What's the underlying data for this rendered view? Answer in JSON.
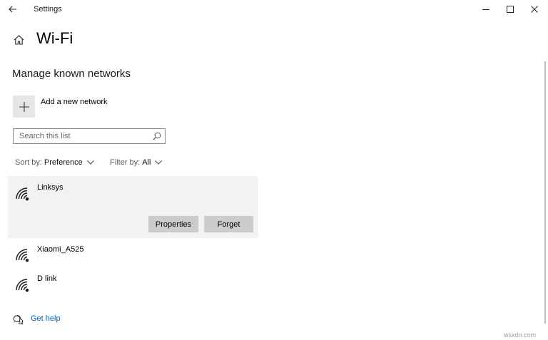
{
  "window": {
    "title": "Settings",
    "back_icon": "back-arrow-icon",
    "controls": [
      "minimize-icon",
      "maximize-icon",
      "close-icon"
    ]
  },
  "page": {
    "title": "Wi-Fi",
    "home_icon": "home-icon",
    "section_title": "Manage known networks"
  },
  "add_network": {
    "label": "Add a new network",
    "icon": "plus-icon"
  },
  "search": {
    "placeholder": "Search this list",
    "value": "",
    "icon": "search-icon"
  },
  "sort": {
    "label": "Sort by:",
    "value": "Preference"
  },
  "filter": {
    "label": "Filter by:",
    "value": "All"
  },
  "networks": [
    {
      "name": "Linksys",
      "selected": true,
      "icon": "wifi-secured-icon"
    },
    {
      "name": "Xiaomi_A525",
      "selected": false,
      "icon": "wifi-secured-icon"
    },
    {
      "name": "D link",
      "selected": false,
      "icon": "wifi-secured-icon"
    }
  ],
  "actions": {
    "properties_label": "Properties",
    "forget_label": "Forget"
  },
  "help": {
    "label": "Get help",
    "icon": "help-chat-icon"
  },
  "colors": {
    "accent_link": "#0063b1",
    "selected_row_bg": "#f2f2f2",
    "button_bg": "#cccccc",
    "add_tile_bg": "#e6e6e6"
  },
  "watermark": "wsxdn.com"
}
